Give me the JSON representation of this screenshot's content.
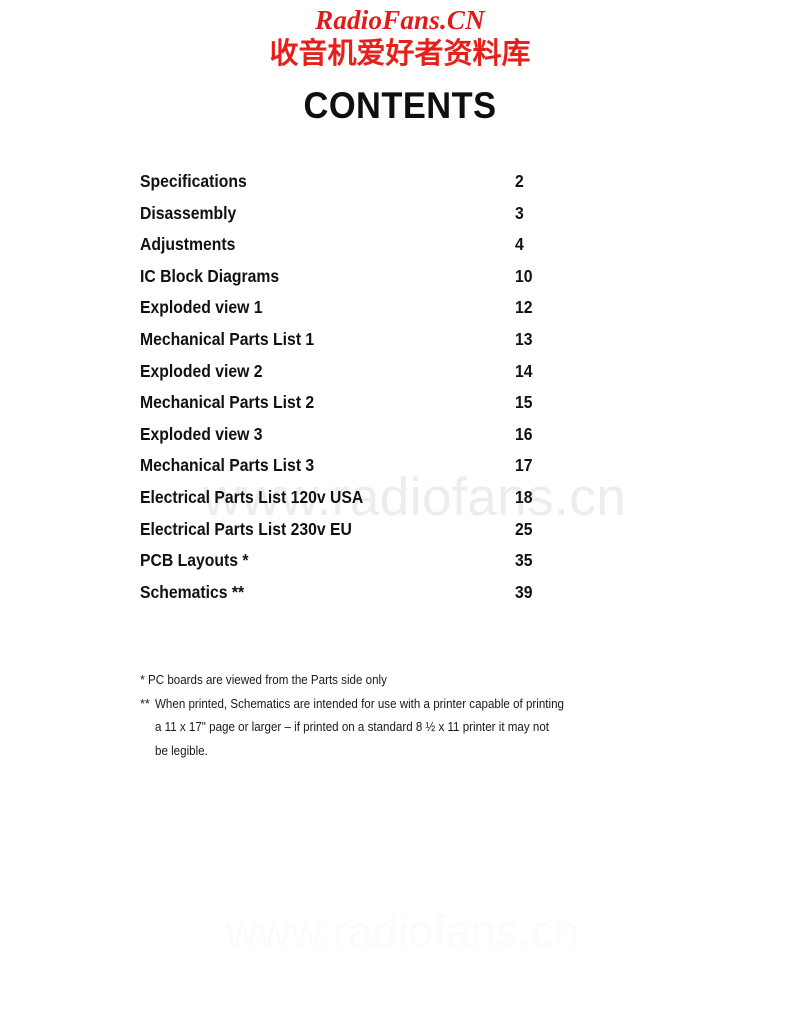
{
  "header": {
    "brand_latin": "RadioFans.CN",
    "brand_cjk": "收音机爱好者资料库",
    "title": "CONTENTS",
    "brand_color": "#e01b18",
    "title_color": "#100f0f"
  },
  "watermarks": {
    "middle": "www.radiofans.cn",
    "lower": "www.radiofans.cn",
    "color": "#ededed"
  },
  "contents": {
    "entries": [
      {
        "label": "Specifications",
        "page": "2"
      },
      {
        "label": "Disassembly",
        "page": "3"
      },
      {
        "label": "Adjustments",
        "page": "4"
      },
      {
        "label": "IC Block Diagrams",
        "page": "10"
      },
      {
        "label": "Exploded view 1",
        "page": "12"
      },
      {
        "label": "Mechanical Parts List 1",
        "page": "13"
      },
      {
        "label": "Exploded view 2",
        "page": "14"
      },
      {
        "label": "Mechanical Parts List 2",
        "page": "15"
      },
      {
        "label": "Exploded view 3",
        "page": "16"
      },
      {
        "label": "Mechanical Parts List 3",
        "page": "17"
      },
      {
        "label": "Electrical Parts List  120v USA",
        "page": "18"
      },
      {
        "label": "Electrical Parts List  230v EU",
        "page": "25"
      },
      {
        "label": "PCB Layouts *",
        "page": "35"
      },
      {
        "label": "Schematics **",
        "page": "39"
      }
    ]
  },
  "footnotes": {
    "mark_single": "*",
    "mark_double": "**",
    "note1": "PC boards are viewed from the Parts side only",
    "note2_line1": "When printed, Schematics are intended for use with a printer capable of printing",
    "note2_line2": "a 11 x 17\" page or larger – if printed on a standard 8 ½ x 11 printer it may not",
    "note2_line3": "be legible."
  }
}
